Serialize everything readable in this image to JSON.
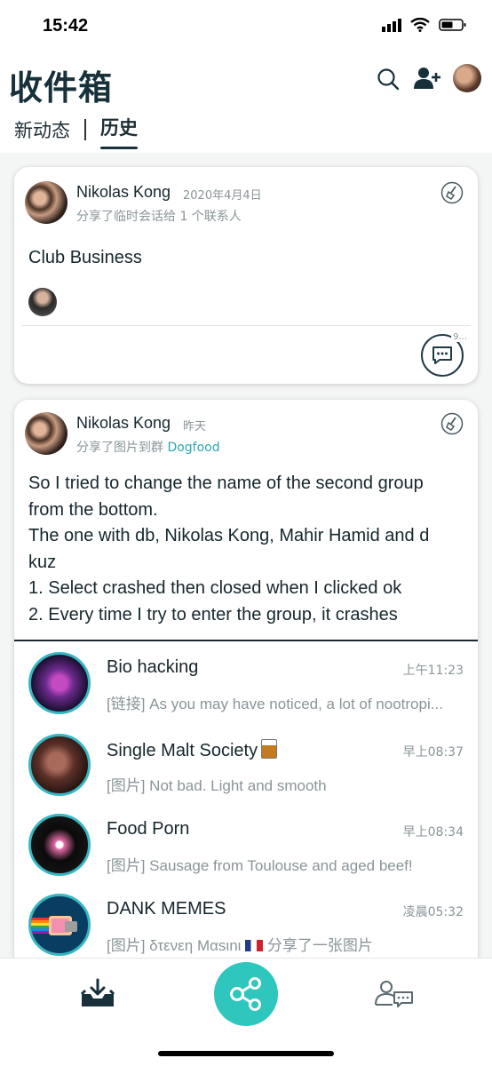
{
  "status_bar": {
    "time": "15:42"
  },
  "header": {
    "title": "收件箱",
    "tabs": [
      {
        "label": "新动态",
        "active": false
      },
      {
        "label": "历史",
        "active": true
      }
    ]
  },
  "posts": [
    {
      "poster": "Nikolas Kong",
      "date": "2020年4月4日",
      "action": "分享了临时会话给 1 个联系人",
      "text_lines": [
        "Club Business"
      ],
      "comment_count": "9..."
    },
    {
      "poster": "Nikolas Kong",
      "date": "昨天",
      "action_prefix": "分享了图片到群",
      "action_group": "Dogfood",
      "text_lines": [
        "So I tried to change the name of the second group",
        "from the bottom.",
        "The one with db, Nikolas Kong, Mahir Hamid and d",
        "kuz",
        "1. Select crashed then closed when I clicked ok",
        "2. Every time I try to enter the group, it crashes"
      ]
    }
  ],
  "groups": [
    {
      "name": "Bio hacking",
      "time": "上午11:23",
      "message": "[链接] As you may have noticed, a lot of nootropi..."
    },
    {
      "name": "Single Malt Society",
      "time": "早上08:37",
      "message": "[图片] Not bad.  Light and smooth"
    },
    {
      "name": "Food Porn",
      "time": "早上08:34",
      "message": "[图片] Sausage from Toulouse and aged beef!"
    },
    {
      "name": "DANK MEMES",
      "time": "凌晨05:32",
      "message_prefix": "[图片] δτενεη Μαsιnι",
      "message_suffix": "分享了一张图片"
    }
  ],
  "colors": {
    "accent": "#2ec6bd",
    "link": "#2fa6b4",
    "title": "#17303a",
    "ring": "#38b7c2"
  }
}
